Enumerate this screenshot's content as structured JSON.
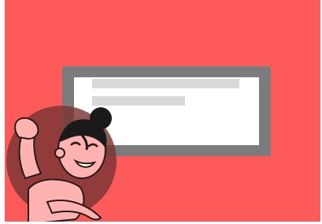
{
  "colors": {
    "page_background": "#ffffff",
    "stage_background": "#ff5a5a",
    "dialog_frame": "#7c7c7c",
    "dialog_panel": "#ffffff",
    "skeleton_line": "#d9d9d9",
    "mascot_circle": "#7a3434",
    "mascot_skin": "#ffb3b0",
    "mascot_outline": "#2a1a1a",
    "mascot_hair": "#1a1a1a"
  },
  "dialog": {
    "skeleton_lines": 2
  },
  "mascot": {
    "icon": "mascot-girl-waving-icon"
  }
}
